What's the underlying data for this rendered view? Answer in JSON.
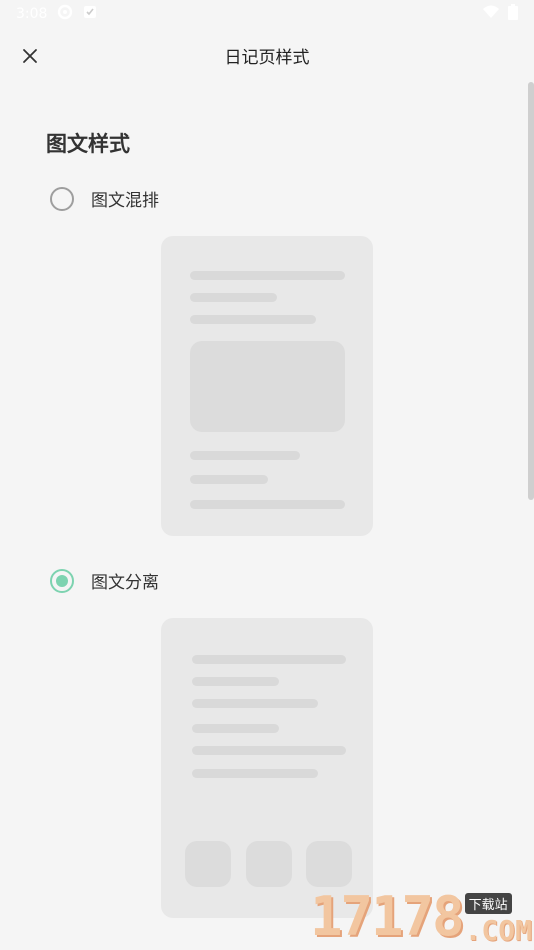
{
  "status_bar": {
    "time": "3:08"
  },
  "header": {
    "title": "日记页样式"
  },
  "section": {
    "title": "图文样式"
  },
  "options": [
    {
      "label": "图文混排",
      "selected": false
    },
    {
      "label": "图文分离",
      "selected": true
    }
  ],
  "watermark": {
    "number": "17178",
    "tag": "下载站",
    "domain": ".COM"
  },
  "colors": {
    "accent": "#7dd3b0",
    "background": "#f5f5f5",
    "preview_bg": "#e8e8e8"
  }
}
